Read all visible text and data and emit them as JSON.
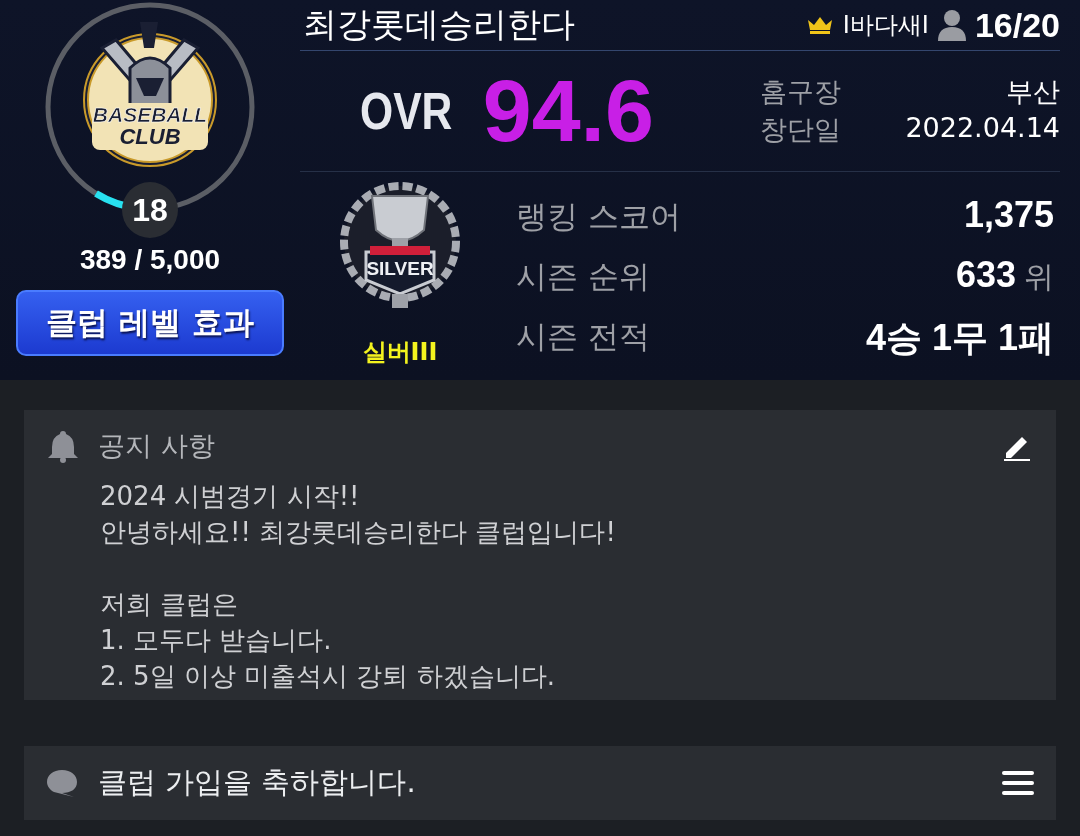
{
  "club": {
    "emblem_text": [
      "BASEBALL",
      "CLUB"
    ],
    "club_level": "18",
    "level": 0.075,
    "exp": "389 / 5,000",
    "level_effect_button": "클럽 레벨 효과"
  },
  "header": {
    "name": "최강롯데승리한다",
    "master": "I바다새I",
    "members": "16/20"
  },
  "ovr": {
    "label": "OVR",
    "value": "94.6"
  },
  "info": [
    {
      "label": "홈구장",
      "value": "부산"
    },
    {
      "label": "창단일",
      "value": "2022.04.14"
    }
  ],
  "league": {
    "badge_text": "SILVER",
    "tier": "실버III"
  },
  "stats": [
    {
      "label": "랭킹 스코어",
      "value": "1,375"
    },
    {
      "label": "시즌 순위",
      "value": "633",
      "unit": "위"
    },
    {
      "label": "시즌 전적",
      "value": "4승 1무 1패"
    }
  ],
  "notice": {
    "title": "공지 사항",
    "paragraphs": [
      "2024 시범경기 시작!!\n안녕하세요!! 최강롯데승리한다 클럽입니다!",
      "저희 클럽은\n1. 모두다 받습니다.\n2. 5일 이상 미출석시 강퇴 하겠습니다."
    ]
  },
  "chat": {
    "text": "클럽 가입을 축하합니다."
  }
}
